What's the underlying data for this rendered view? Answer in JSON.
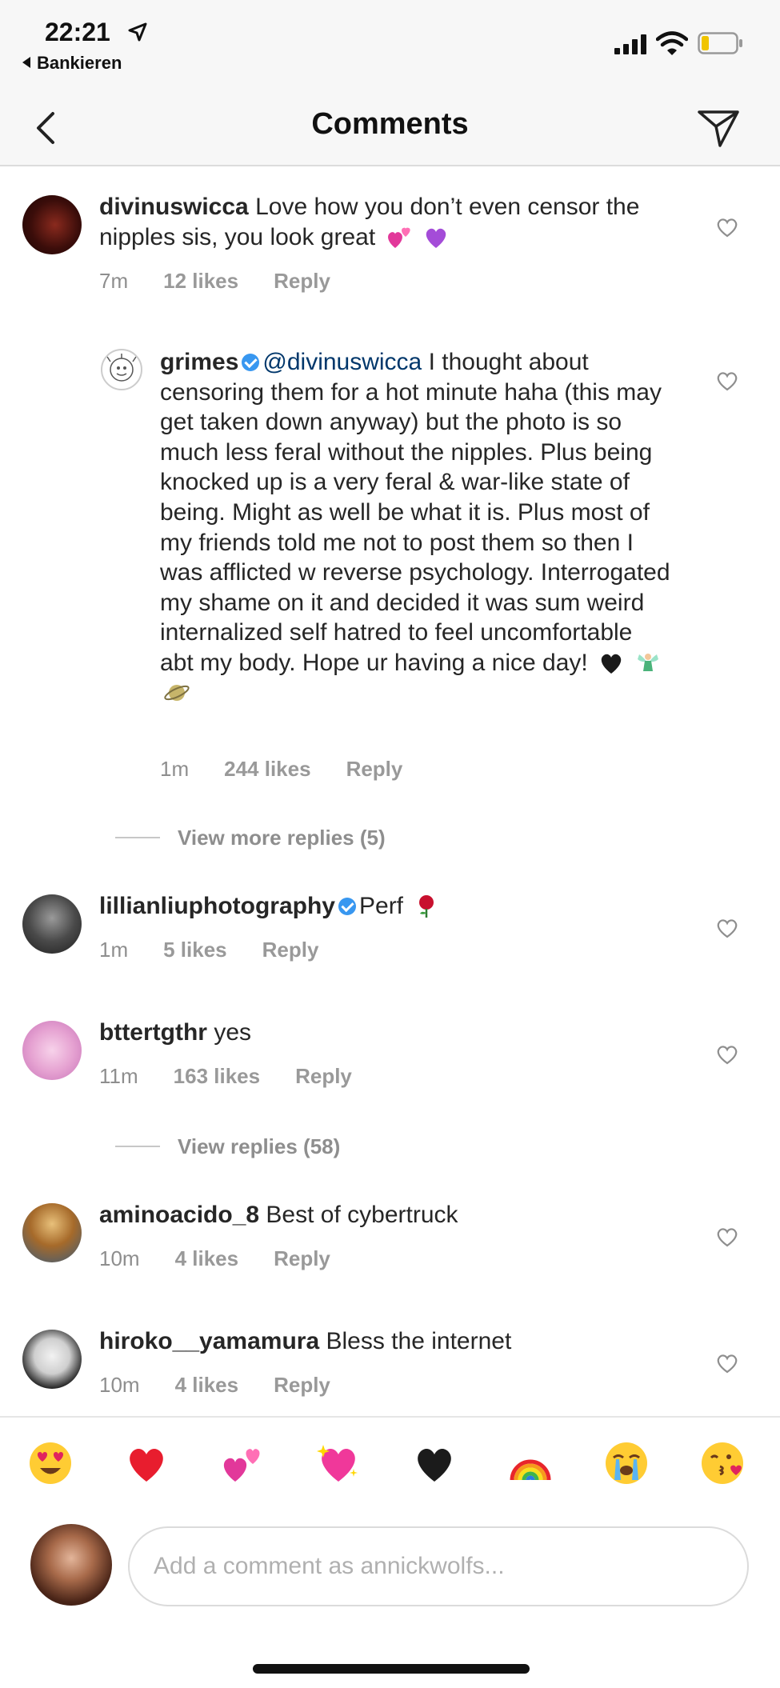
{
  "status_bar": {
    "time": "22:21",
    "back_app": "Bankieren",
    "icons": [
      "location-arrow-icon",
      "signal-icon",
      "wifi-icon",
      "battery-icon"
    ]
  },
  "nav": {
    "title": "Comments",
    "icons": [
      "back-chevron-icon",
      "send-icon"
    ]
  },
  "comments": [
    {
      "username": "divinuswicca",
      "text": "Love how you don’t even censor the nipples sis, you look great",
      "emojis": [
        "two-hearts-emoji",
        "purple-heart-emoji"
      ],
      "time": "7m",
      "likes": "12 likes",
      "reply": "Reply"
    },
    {
      "username": "grimes",
      "verified": true,
      "mention": "@divinuswicca",
      "text": "I thought about censoring them for a hot minute haha (this may get taken down anyway) but the photo is so much less feral without the nipples.  Plus being knocked up is a very feral & war-like state of being.  Might as well be what it is.  Plus most of my friends told me not to post them so then I was afflicted w reverse psychology. Interrogated my shame on it and decided it was sum weird internalized self hatred to feel uncomfortable abt my body.  Hope ur having a nice day!",
      "emojis": [
        "black-heart-emoji",
        "fairy-emoji",
        "ringed-planet-emoji"
      ],
      "time": "1m",
      "likes": "244 likes",
      "reply": "Reply"
    },
    {
      "username": "lillianliuphotography",
      "verified": true,
      "text": "Perf",
      "emojis": [
        "rose-emoji"
      ],
      "time": "1m",
      "likes": "5 likes",
      "reply": "Reply"
    },
    {
      "username": "bttertgthr",
      "text": "yes",
      "time": "11m",
      "likes": "163 likes",
      "reply": "Reply"
    },
    {
      "username": "aminoacido_8",
      "text": "Best of cybertruck",
      "time": "10m",
      "likes": "4 likes",
      "reply": "Reply"
    },
    {
      "username": "hiroko__yamamura",
      "text": "Bless the internet",
      "time": "10m",
      "likes": "4 likes",
      "reply": "Reply"
    }
  ],
  "view_more_replies": "View more replies (5)",
  "view_replies": "View replies (58)",
  "emoji_bar": [
    "heart-eyes-emoji",
    "red-heart-emoji",
    "two-hearts-emoji",
    "sparkling-heart-emoji",
    "black-heart-emoji",
    "rainbow-emoji",
    "crying-emoji",
    "kissing-emoji"
  ],
  "input": {
    "placeholder": "Add a comment as annickwolfs..."
  },
  "colors": {
    "text": "#262626",
    "secondary": "#8e8e8e",
    "mention": "#00376b",
    "verified": "#3897f0",
    "bar_bg": "#f7f7f7"
  }
}
